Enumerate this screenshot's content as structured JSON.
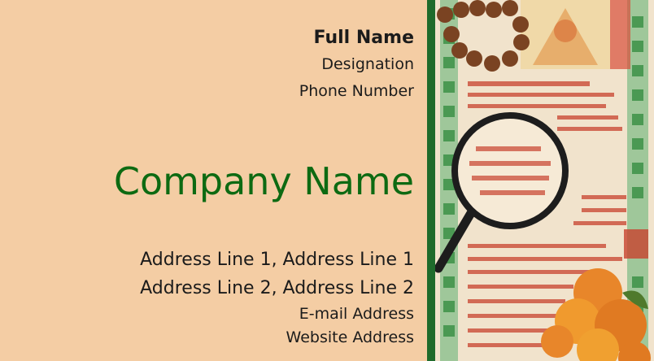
{
  "card": {
    "full_name": "Full Name",
    "designation": "Designation",
    "phone": "Phone Number",
    "company": "Company Name",
    "address_line_1": "Address Line 1,  Address Line 1",
    "address_line_2": "Address Line 2,  Address Line 2",
    "email": "E-mail Address",
    "website": "Website Address"
  },
  "colors": {
    "background": "#f4cda4",
    "accent_green": "#0d6a12",
    "divider": "#1f6b2c"
  },
  "image": {
    "subject": "magnifying-glass-on-hindu-almanac"
  }
}
